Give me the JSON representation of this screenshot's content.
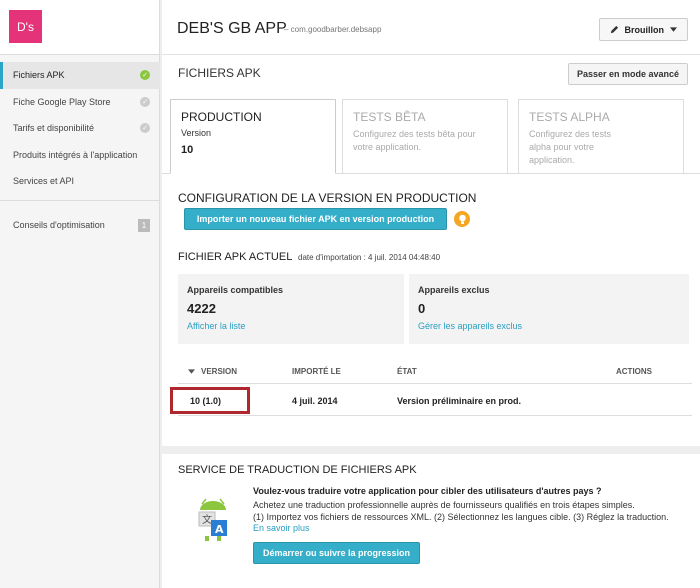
{
  "logo": {
    "text": "D's"
  },
  "sidebar": {
    "items": [
      {
        "label": "Fichiers APK",
        "status": "✓"
      },
      {
        "label": "Fiche Google Play Store",
        "status": "✓"
      },
      {
        "label": "Tarifs et disponibilité",
        "status": "✓"
      },
      {
        "label": "Produits intégrés à l'application"
      },
      {
        "label": "Services et API"
      }
    ],
    "bottom": {
      "label": "Conseils d'optimisation",
      "count": "1"
    }
  },
  "header": {
    "title": "DEB'S GB APP",
    "package": "– com.goodbarber.debsapp",
    "status_button": "Brouillon"
  },
  "page": {
    "title": "FICHIERS APK",
    "advanced_button": "Passer en mode avancé"
  },
  "tabs": [
    {
      "name": "PRODUCTION",
      "sub": "Version",
      "version": "10"
    },
    {
      "name": "TESTS BÊTA",
      "desc": "Configurez des tests bêta pour votre application."
    },
    {
      "name": "TESTS ALPHA",
      "desc": "Configurez des tests alpha pour votre application."
    }
  ],
  "config": {
    "title": "CONFIGURATION DE LA VERSION EN PRODUCTION",
    "import_button": "Importer un nouveau fichier APK en version production"
  },
  "apk": {
    "title": "FICHIER APK ACTUEL",
    "date": "date d'importation : 4 juil. 2014 04:48:40",
    "compatible": {
      "label": "Appareils compatibles",
      "value": "4222",
      "link": "Afficher la liste"
    },
    "excluded": {
      "label": "Appareils exclus",
      "value": "0",
      "link": "Gérer les appareils exclus"
    }
  },
  "table": {
    "headers": {
      "version": "VERSION",
      "imported": "IMPORTÉ LE",
      "state": "ÉTAT",
      "actions": "ACTIONS"
    },
    "rows": [
      {
        "version": "10 (1.0)",
        "imported": "4 juil. 2014",
        "state": "Version préliminaire en prod."
      }
    ]
  },
  "translation": {
    "title": "SERVICE DE TRADUCTION DE FICHIERS APK",
    "question": "Voulez-vous traduire votre application pour cibler des utilisateurs d'autres pays ?",
    "text1": "Achetez une traduction professionnelle auprès de fournisseurs qualifiés en trois étapes simples.",
    "text2": "(1) Importez vos fichiers de ressources XML. (2) Sélectionnez les langues cible. (3) Réglez la traduction.",
    "link": "En savoir plus",
    "button": "Démarrer ou suivre la progression"
  },
  "colors": {
    "accent": "#34aec9",
    "brand": "#e5337a",
    "highlight_box": "#b0282e",
    "ok": "#8cc63f"
  }
}
